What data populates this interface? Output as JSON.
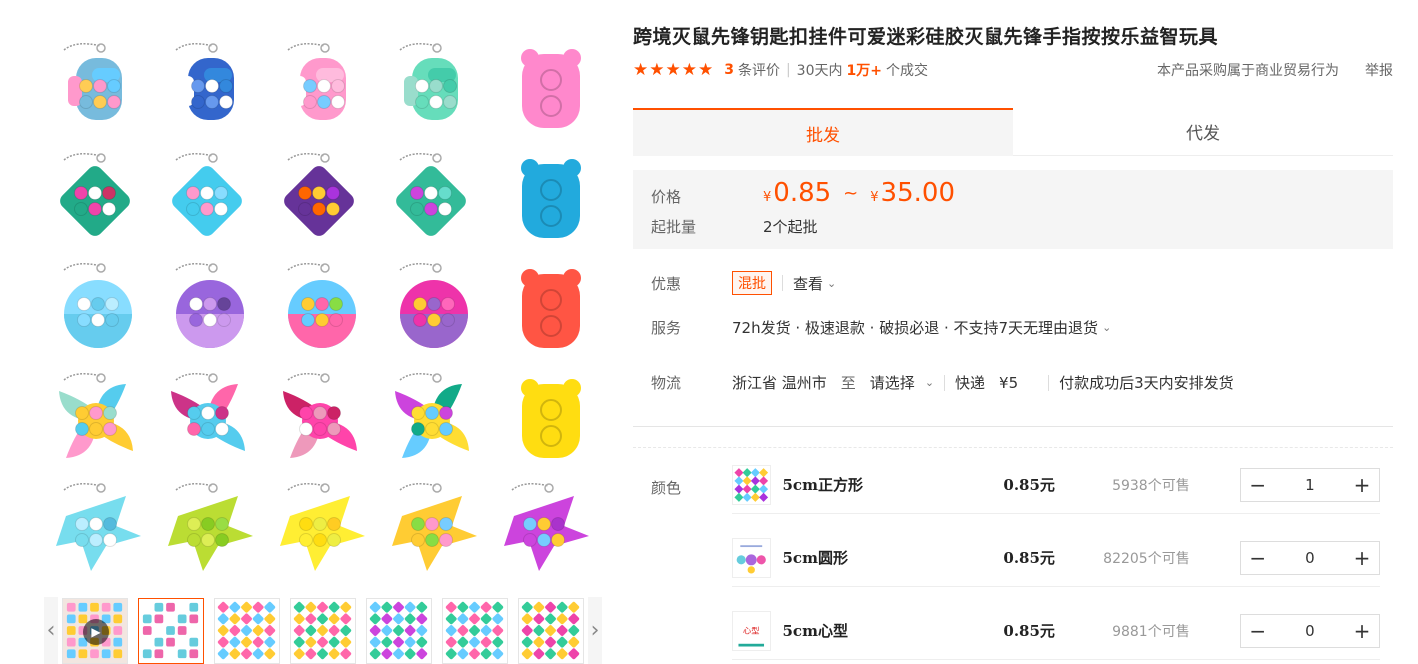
{
  "product": {
    "title": "跨境灭鼠先锋钥匙扣挂件可爱迷彩硅胶灭鼠先锋手指按按乐益智玩具",
    "stars": "★★★★★",
    "review_count": "3",
    "review_label": "条评价",
    "sales_prefix": "30天内",
    "sales_count": "1万+",
    "sales_suffix": "个成交",
    "trade_note": "本产品采购属于商业贸易行为",
    "report_label": "举报"
  },
  "tabs": [
    "批发",
    "代发"
  ],
  "price_box": {
    "price_label": "价格",
    "currency": "¥",
    "price_low": "0.85",
    "tilde": "~",
    "price_high": "35.00",
    "moq_label": "起批量",
    "moq_value": "2个起批"
  },
  "promo": {
    "label": "优惠",
    "badge": "混批",
    "view_label": "查看"
  },
  "service": {
    "label": "服务",
    "value": "72h发货 · 极速退款 · 破损必退 · 不支持7天无理由退货"
  },
  "logistics": {
    "label": "物流",
    "origin": "浙江省 温州市",
    "to": "至",
    "destination": "请选择",
    "method": "快递",
    "fee": "¥5",
    "ship_note": "付款成功后3天内安排发货"
  },
  "variants": {
    "label": "颜色",
    "items": [
      {
        "name": "5cm正方形",
        "price": "0.85元",
        "stock": "5938个可售",
        "qty": "1",
        "thumb_text": ""
      },
      {
        "name": "5cm圆形",
        "price": "0.85元",
        "stock": "82205个可售",
        "qty": "0",
        "thumb_text": ""
      },
      {
        "name": "5cm心型",
        "price": "0.85元",
        "stock": "9881个可售",
        "qty": "0",
        "thumb_text": "心型"
      }
    ]
  },
  "stepper": {
    "minus": "−",
    "plus": "+"
  },
  "nav": {
    "prev": "‹",
    "next": "›",
    "play": "▶"
  },
  "colors": {
    "accent": "#ff5000",
    "price_bg": "#f5f5f5"
  }
}
